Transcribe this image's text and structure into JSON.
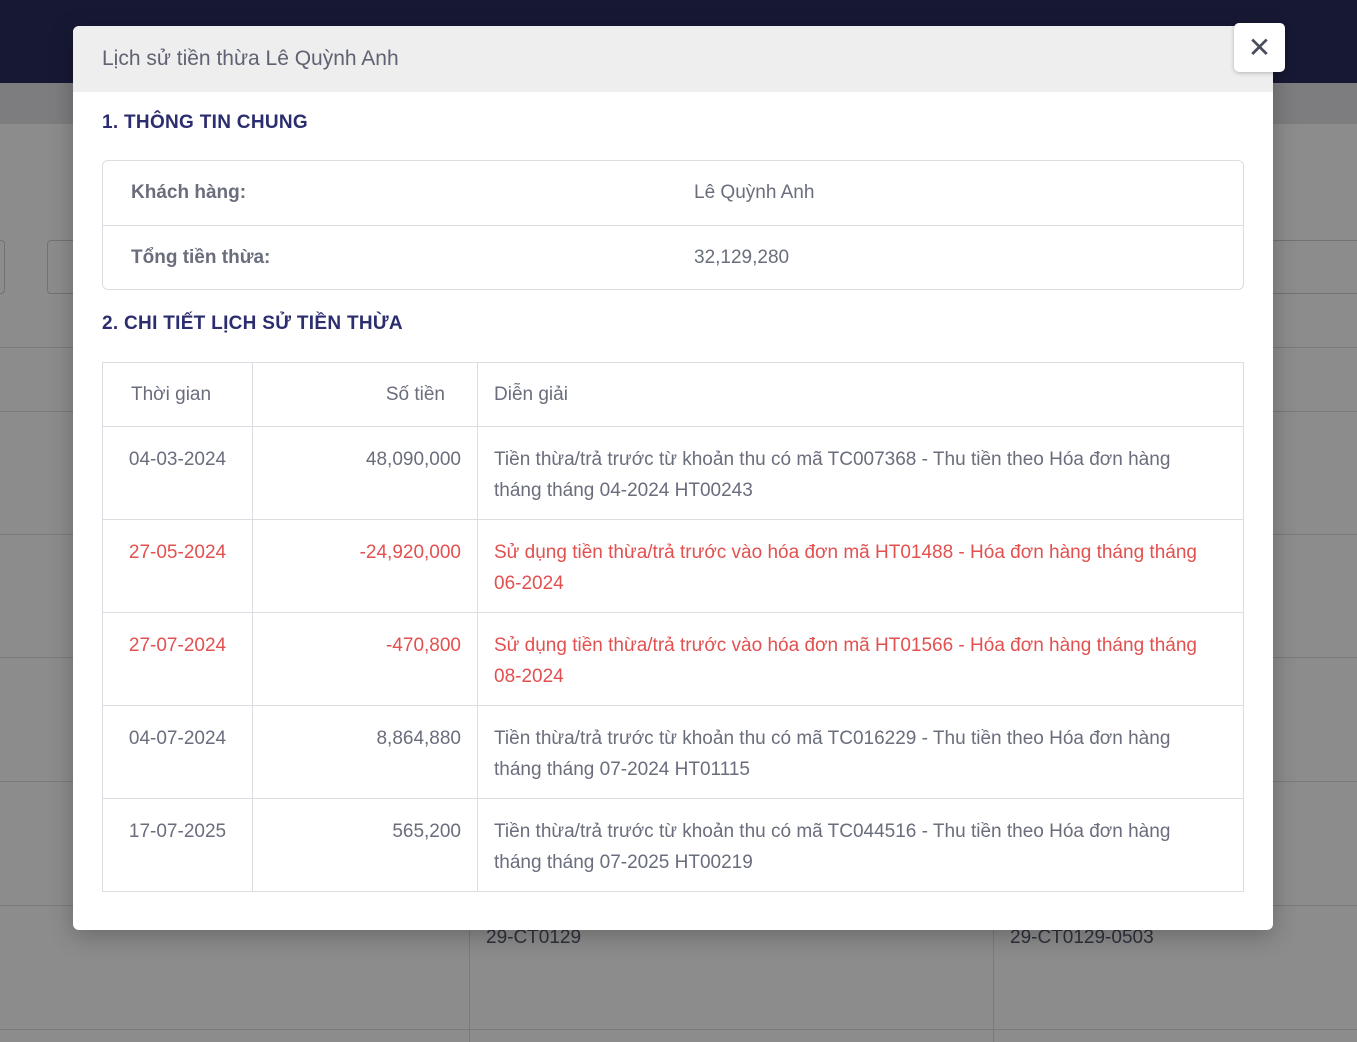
{
  "background": {
    "row_cells": [
      "29-CT0129",
      "29-CT0129-0503"
    ]
  },
  "modal": {
    "title": "Lịch sử tiền thừa Lê Quỳnh Anh",
    "close_icon": "close-icon",
    "section1_title": "1. THÔNG TIN CHUNG",
    "info": [
      {
        "label": "Khách hàng:",
        "value": "Lê Quỳnh Anh"
      },
      {
        "label": "Tổng tiền thừa:",
        "value": "32,129,280"
      }
    ],
    "section2_title": "2. CHI TIẾT LỊCH SỬ TIỀN THỪA",
    "table": {
      "headers": [
        "Thời gian",
        "Số tiền",
        "Diễn giải"
      ],
      "rows": [
        {
          "time": "04-03-2024",
          "amount": "48,090,000",
          "desc": "Tiền thừa/trả trước từ khoản thu có mã TC007368 - Thu tiền theo Hóa đơn hàng tháng tháng 04-2024 HT00243",
          "negative": false
        },
        {
          "time": "27-05-2024",
          "amount": "-24,920,000",
          "desc": "Sử dụng tiền thừa/trả trước vào hóa đơn mã HT01488 - Hóa đơn hàng tháng tháng 06-2024",
          "negative": true
        },
        {
          "time": "27-07-2024",
          "amount": "-470,800",
          "desc": "Sử dụng tiền thừa/trả trước vào hóa đơn mã HT01566 - Hóa đơn hàng tháng tháng 08-2024",
          "negative": true
        },
        {
          "time": "04-07-2024",
          "amount": "8,864,880",
          "desc": "Tiền thừa/trả trước từ khoản thu có mã TC016229 - Thu tiền theo Hóa đơn hàng tháng tháng 07-2024 HT01115",
          "negative": false
        },
        {
          "time": "17-07-2025",
          "amount": "565,200",
          "desc": "Tiền thừa/trả trước từ khoản thu có mã TC044516 - Thu tiền theo Hóa đơn hàng tháng tháng 07-2025 HT00219",
          "negative": false
        }
      ]
    }
  },
  "colors": {
    "header_bar": "#2b2d5e",
    "section_title": "#2b2d6e",
    "negative_text": "#e2504f"
  }
}
